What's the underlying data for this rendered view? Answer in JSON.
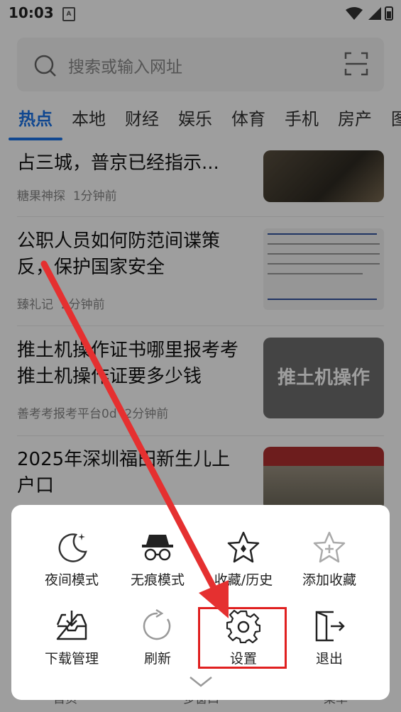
{
  "status": {
    "time": "10:03",
    "sim_label": "A"
  },
  "search": {
    "placeholder": "搜索或输入网址"
  },
  "tabs": [
    "热点",
    "本地",
    "财经",
    "娱乐",
    "体育",
    "手机",
    "房产",
    "图"
  ],
  "news": [
    {
      "title": "占三城，普京已经指示...",
      "source": "糖果神探",
      "time": "1分钟前"
    },
    {
      "title": "公职人员如何防范间谍策反，保护国家安全",
      "source": "臻礼记",
      "time": "2分钟前"
    },
    {
      "title": "推土机操作证书哪里报考考推土机操作证要多少钱",
      "source": "善考考报考平台0",
      "source_suffix": "d",
      "time": "2分钟前",
      "thumb_text": "推土机操作"
    },
    {
      "title": "2025年深圳福田新生儿上户口"
    }
  ],
  "bottom_nav": [
    "首页",
    "多窗口",
    "菜单"
  ],
  "menu": {
    "row1": [
      {
        "label": "夜间模式",
        "icon": "night-mode-icon"
      },
      {
        "label": "无痕模式",
        "icon": "incognito-icon"
      },
      {
        "label": "收藏/历史",
        "icon": "favorites-history-icon"
      },
      {
        "label": "添加收藏",
        "icon": "add-favorite-icon"
      }
    ],
    "row2": [
      {
        "label": "下载管理",
        "icon": "download-icon"
      },
      {
        "label": "刷新",
        "icon": "refresh-icon"
      },
      {
        "label": "设置",
        "icon": "settings-icon"
      },
      {
        "label": "退出",
        "icon": "exit-icon"
      }
    ]
  },
  "colors": {
    "accent": "#1a73e8",
    "annotation": "#e02020"
  }
}
